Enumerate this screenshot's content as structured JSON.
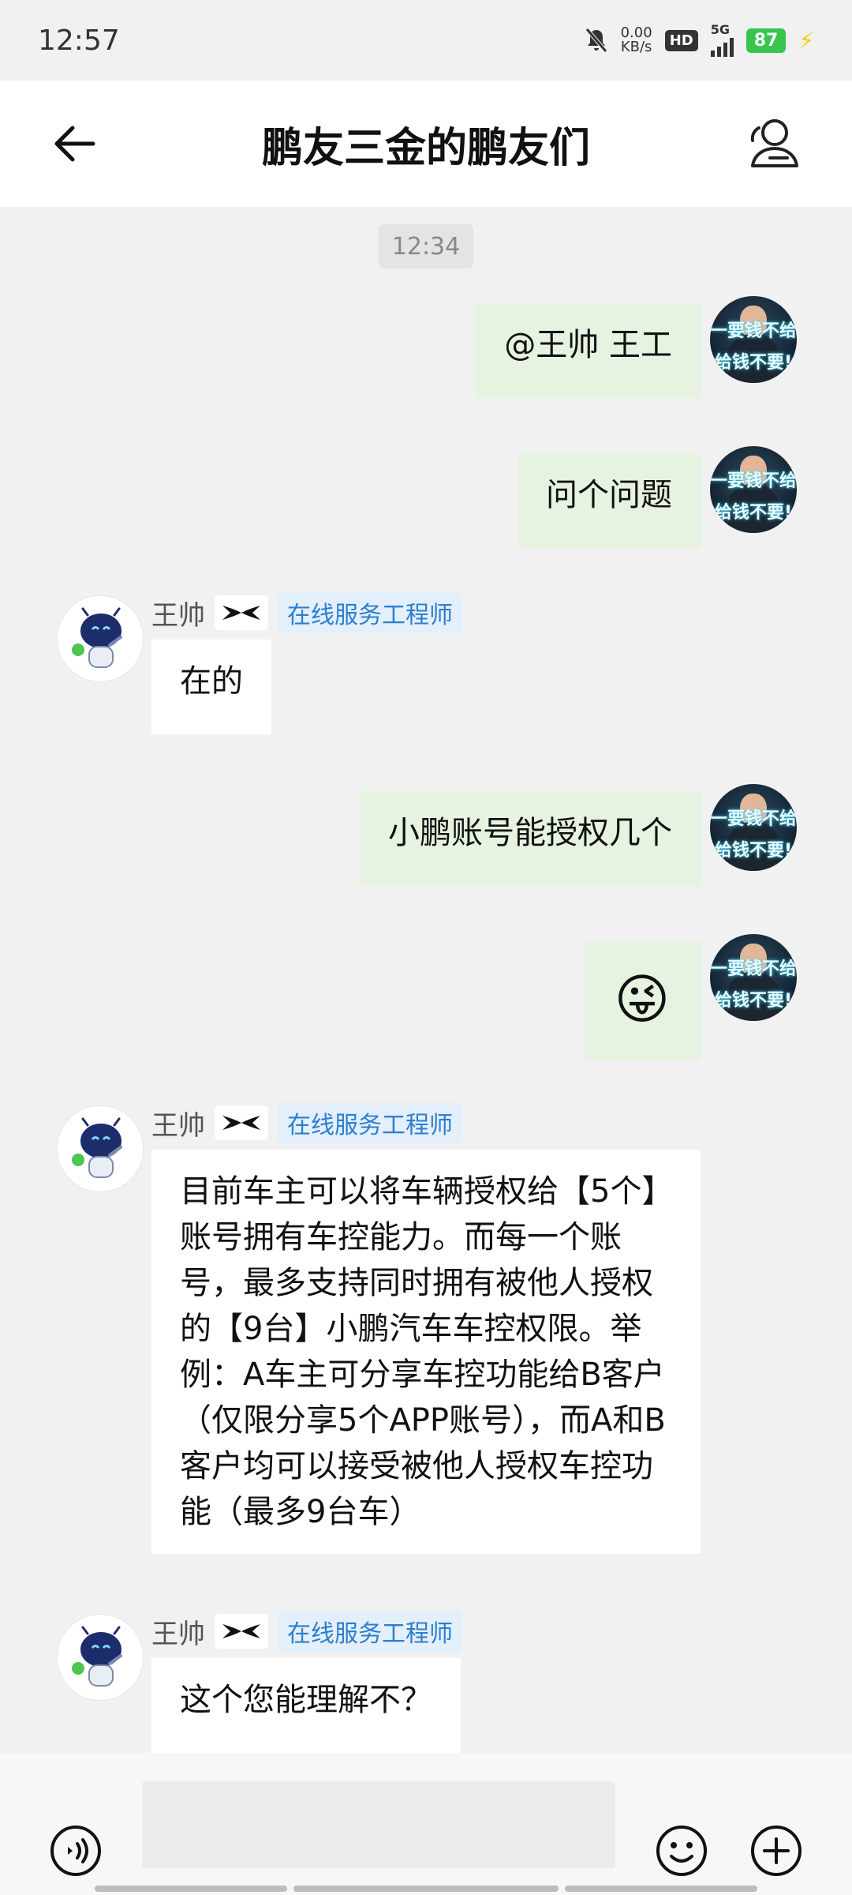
{
  "status_bar": {
    "time": "12:57",
    "net_speed_value": "0.00",
    "net_speed_unit": "KB/s",
    "hd": "HD",
    "network": "5G",
    "battery": "87"
  },
  "header": {
    "title": "鹏友三金的鹏友们"
  },
  "chat": {
    "timestamp": "12:34",
    "messages": [
      {
        "side": "me",
        "text": "@王帅 王工"
      },
      {
        "side": "me",
        "text": "问个问题"
      },
      {
        "side": "bot",
        "sender": "王帅",
        "role": "在线服务工程师",
        "text": "在的"
      },
      {
        "side": "me",
        "text": "小鹏账号能授权几个"
      },
      {
        "side": "me",
        "text": "😜"
      },
      {
        "side": "bot",
        "sender": "王帅",
        "role": "在线服务工程师",
        "text": "目前车主可以将车辆授权给【5个】账号拥有车控能力。而每一个账号，最多支持同时拥有被他人授权的【9台】小鹏汽车车控权限。举例：A车主可分享车控功能给B客户（仅限分享5个APP账号），而A和B客户均可以接受被他人授权车控功能（最多9台车）"
      },
      {
        "side": "bot",
        "sender": "王帅",
        "role": "在线服务工程师",
        "text": "这个您能理解不？"
      }
    ],
    "my_avatar_text_line1": "一要钱不给",
    "my_avatar_text_line2": "给钱不要!"
  },
  "input": {
    "value": "",
    "placeholder": ""
  },
  "icons": {
    "back": "back-arrow-icon",
    "members": "group-members-icon",
    "voice": "voice-input-icon",
    "emoji": "emoji-icon",
    "more": "plus-icon",
    "brand": "xpeng-logo-icon",
    "robot": "robot-avatar"
  }
}
